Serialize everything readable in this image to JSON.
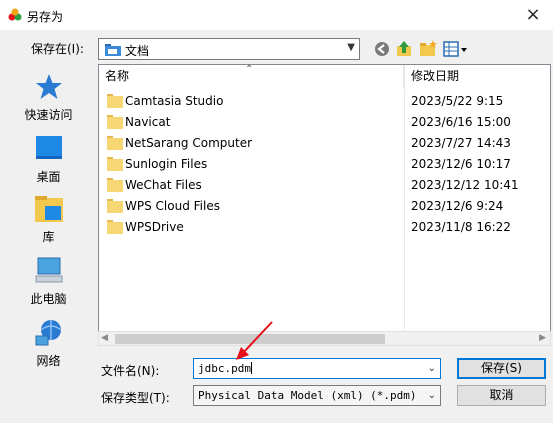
{
  "window": {
    "title": "另存为",
    "close_glyph": "×"
  },
  "toolbar": {
    "save_in_label": "保存在(I):",
    "save_in_value": "文档",
    "icons": [
      "back-icon",
      "up-folder-icon",
      "new-folder-icon",
      "view-menu-icon"
    ]
  },
  "places": [
    {
      "label": "快速访问",
      "icon": "star-icon"
    },
    {
      "label": "桌面",
      "icon": "desktop-icon"
    },
    {
      "label": "库",
      "icon": "library-icon"
    },
    {
      "label": "此电脑",
      "icon": "computer-icon"
    },
    {
      "label": "网络",
      "icon": "network-icon"
    }
  ],
  "filelist": {
    "columns": {
      "name": "名称",
      "date": "修改日期"
    },
    "rows": [
      {
        "name": "Camtasia Studio",
        "date": "2023/5/22 9:15"
      },
      {
        "name": "Navicat",
        "date": "2023/6/16 15:00"
      },
      {
        "name": "NetSarang Computer",
        "date": "2023/7/27 14:43"
      },
      {
        "name": "Sunlogin Files",
        "date": "2023/12/6 10:17"
      },
      {
        "name": "WeChat Files",
        "date": "2023/12/12 10:41"
      },
      {
        "name": "WPS Cloud Files",
        "date": "2023/12/6 9:24"
      },
      {
        "name": "WPSDrive",
        "date": "2023/11/8 16:22"
      }
    ]
  },
  "form": {
    "filename_label": "文件名(N):",
    "filename_value": "jdbc.pdm",
    "filetype_label": "保存类型(T):",
    "filetype_value": "Physical Data Model (xml) (*.pdm)",
    "save_button": "保存(S)",
    "cancel_button": "取消"
  },
  "colors": {
    "accent": "#0078d7",
    "annotation": "#e8101a",
    "folder": "#f7d774"
  }
}
